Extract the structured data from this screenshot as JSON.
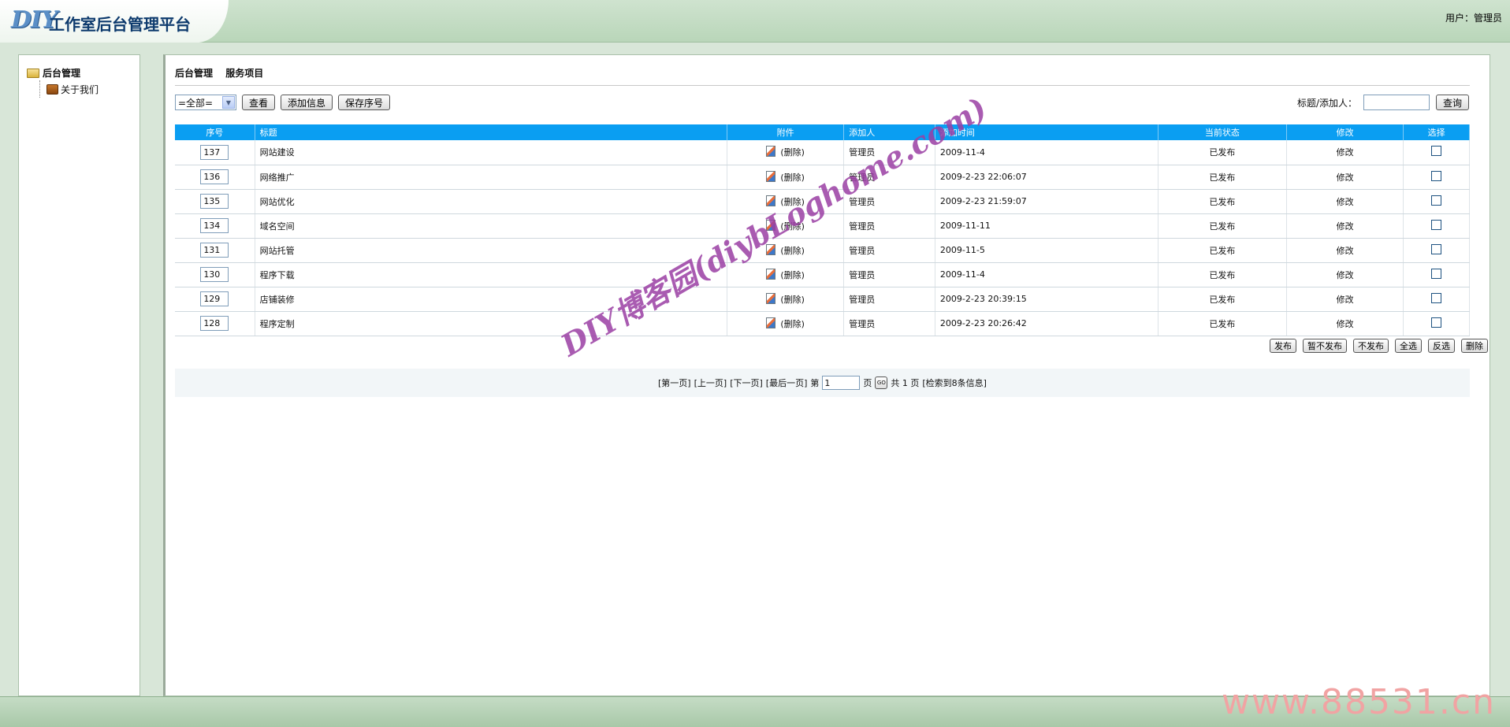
{
  "header": {
    "logo_text": "DIY",
    "app_title": "工作室后台管理平台",
    "user_info": "用户：管理员"
  },
  "sidebar": {
    "root_label": "后台管理",
    "items": [
      {
        "label": "关于我们"
      }
    ]
  },
  "main": {
    "breadcrumb": [
      "后台管理",
      "服务项目"
    ],
    "toolbar": {
      "filter_value": "=全部=",
      "view_label": "查看",
      "add_label": "添加信息",
      "save_order_label": "保存序号"
    },
    "search": {
      "label": "标题/添加人：",
      "button_label": "查询"
    },
    "table": {
      "columns": [
        "序号",
        "标题",
        "附件",
        "添加人",
        "添加时间",
        "当前状态",
        "修改",
        "选择"
      ],
      "rows": [
        {
          "order": "137",
          "title": "网站建设",
          "attachment": "(删除)",
          "author": "管理员",
          "time": "2009-11-4",
          "status": "已发布",
          "edit": "修改"
        },
        {
          "order": "136",
          "title": "网络推广",
          "attachment": "(删除)",
          "author": "管理员",
          "time": "2009-2-23 22:06:07",
          "status": "已发布",
          "edit": "修改"
        },
        {
          "order": "135",
          "title": "网站优化",
          "attachment": "(删除)",
          "author": "管理员",
          "time": "2009-2-23 21:59:07",
          "status": "已发布",
          "edit": "修改"
        },
        {
          "order": "134",
          "title": "域名空间",
          "attachment": "(删除)",
          "author": "管理员",
          "time": "2009-11-11",
          "status": "已发布",
          "edit": "修改"
        },
        {
          "order": "131",
          "title": "网站托管",
          "attachment": "(删除)",
          "author": "管理员",
          "time": "2009-11-5",
          "status": "已发布",
          "edit": "修改"
        },
        {
          "order": "130",
          "title": "程序下载",
          "attachment": "(删除)",
          "author": "管理员",
          "time": "2009-11-4",
          "status": "已发布",
          "edit": "修改"
        },
        {
          "order": "129",
          "title": "店铺装修",
          "attachment": "(删除)",
          "author": "管理员",
          "time": "2009-2-23 20:39:15",
          "status": "已发布",
          "edit": "修改"
        },
        {
          "order": "128",
          "title": "程序定制",
          "attachment": "(删除)",
          "author": "管理员",
          "time": "2009-2-23 20:26:42",
          "status": "已发布",
          "edit": "修改"
        }
      ]
    },
    "actions": [
      "发布",
      "暂不发布",
      "不发布",
      "全选",
      "反选",
      "删除"
    ],
    "pager": {
      "first": "[第一页]",
      "prev": "[上一页]",
      "next": "[下一页]",
      "last": "[最后一页]",
      "page_prefix": "第",
      "page_value": "1",
      "page_suffix": "页",
      "go": "GO",
      "total": "共 1 页",
      "found": "[检索到8条信息]"
    }
  },
  "watermark": "DIY博客园(diybLoghome.com)",
  "corner_watermark": "www.88531.cn",
  "colors": {
    "header_bg": "#b9d6b9",
    "table_header_bg": "#0a9ef2",
    "watermark": "#9b3fa4"
  }
}
